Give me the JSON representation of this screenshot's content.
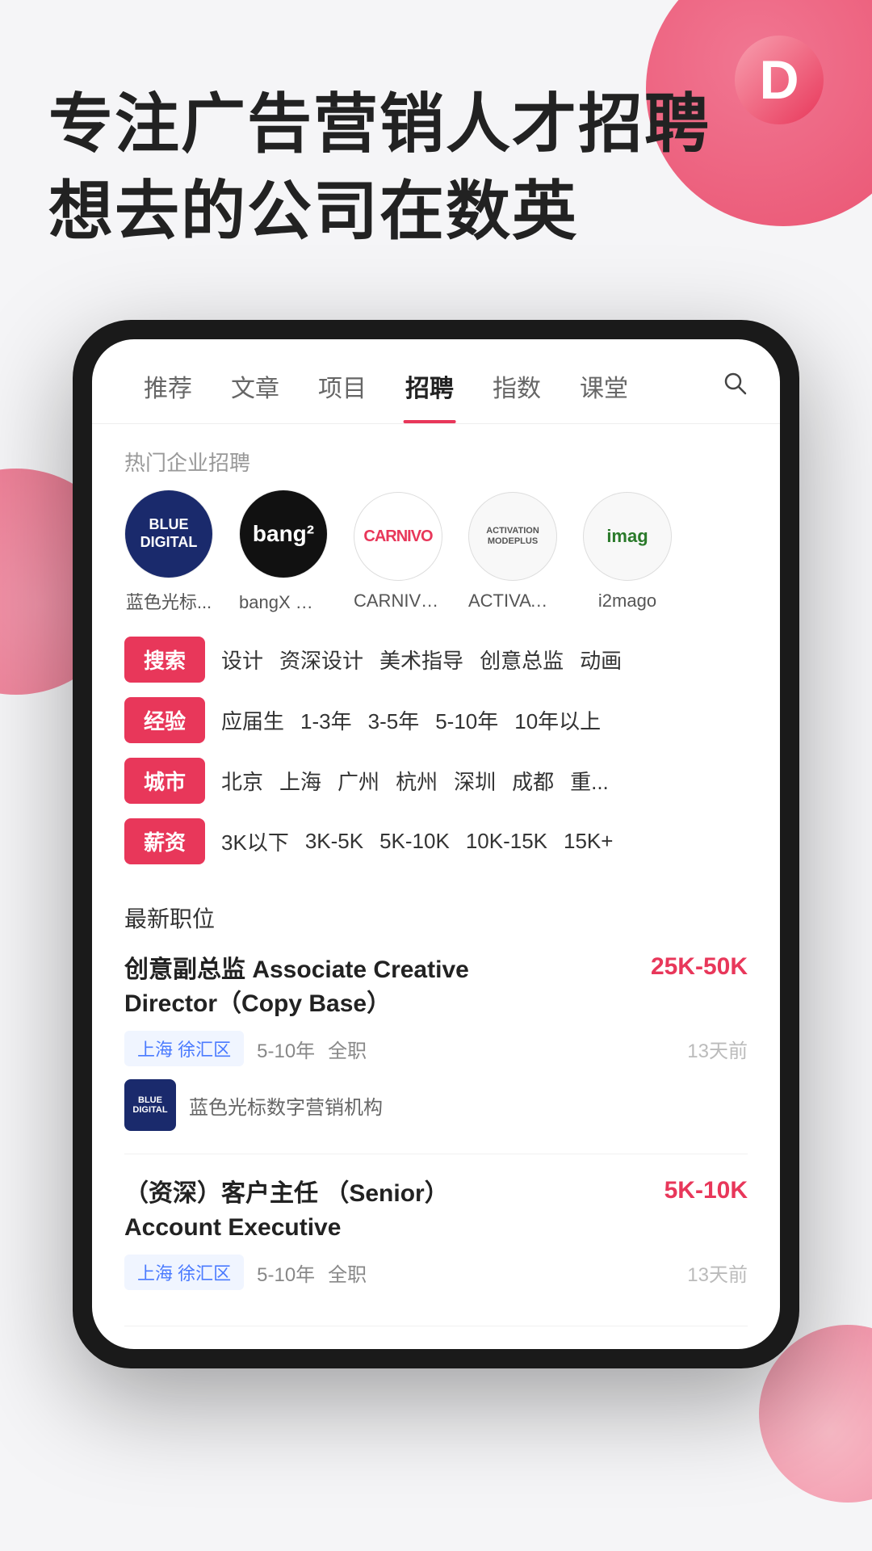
{
  "app": {
    "logo_letter": "D"
  },
  "hero": {
    "line1": "专注广告营销人才招聘",
    "line2": "想去的公司在数英"
  },
  "phone": {
    "nav": {
      "tabs": [
        {
          "label": "推荐",
          "active": false
        },
        {
          "label": "文章",
          "active": false
        },
        {
          "label": "项目",
          "active": false
        },
        {
          "label": "招聘",
          "active": true
        },
        {
          "label": "指数",
          "active": false
        },
        {
          "label": "课堂",
          "active": false
        }
      ],
      "search_icon": "🔍"
    },
    "hot_companies_label": "热门企业招聘",
    "companies": [
      {
        "name": "蓝色光标...",
        "logo_type": "blue_digital",
        "display": "BLUE\nDIGITAL"
      },
      {
        "name": "bangX 上海",
        "logo_type": "bangx",
        "display": "bang²"
      },
      {
        "name": "CARNIVO...",
        "logo_type": "carnivo",
        "display": "CARNIVO"
      },
      {
        "name": "ACTIVATIO...",
        "logo_type": "activation",
        "display": "ACTIVATION\nMODEPLUS"
      },
      {
        "name": "i2mago",
        "logo_type": "i2mago",
        "display": "imag"
      }
    ],
    "filters": [
      {
        "badge": "搜索",
        "tags": [
          "设计",
          "资深设计",
          "美术指导",
          "创意总监",
          "动画"
        ]
      },
      {
        "badge": "经验",
        "tags": [
          "应届生",
          "1-3年",
          "3-5年",
          "5-10年",
          "10年以上"
        ]
      },
      {
        "badge": "城市",
        "tags": [
          "北京",
          "上海",
          "广州",
          "杭州",
          "深圳",
          "成都",
          "重..."
        ]
      },
      {
        "badge": "薪资",
        "tags": [
          "3K以下",
          "3K-5K",
          "5K-10K",
          "10K-15K",
          "15K+"
        ]
      }
    ],
    "latest_jobs_label": "最新职位",
    "jobs": [
      {
        "title": "创意副总监 Associate Creative Director（Copy Base）",
        "salary": "25K-50K",
        "location_tag": "上海 徐汇区",
        "experience": "5-10年",
        "job_type": "全职",
        "time_ago": "13天前",
        "company_name": "蓝色光标数字营销机构",
        "company_logo": "blue_digital"
      },
      {
        "title": "（资深）客户主任 （Senior） Account Executive",
        "salary": "5K-10K",
        "location_tag": "上海 徐汇区",
        "experience": "5-10年",
        "job_type": "全职",
        "time_ago": "13天前",
        "company_name": "",
        "company_logo": ""
      }
    ]
  }
}
